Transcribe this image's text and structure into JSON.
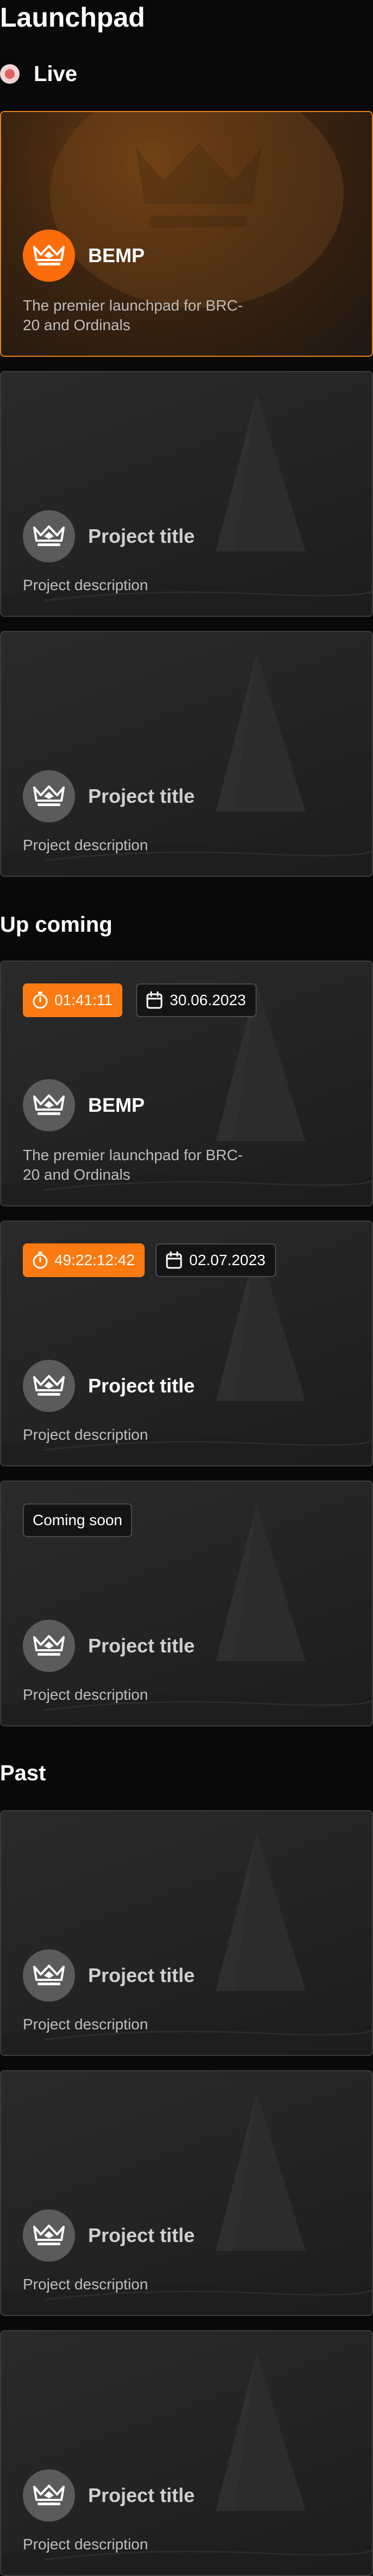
{
  "page": {
    "title": "Launchpad"
  },
  "colors": {
    "accent": "#fb6c0b",
    "card_border": "#3b3b3b",
    "live_border": "#e3841b",
    "background": "#090909"
  },
  "sections": {
    "live": {
      "title": "Live",
      "indicator": "live-indicator-icon"
    },
    "upcoming": {
      "title": "Up coming"
    },
    "past": {
      "title": "Past"
    }
  },
  "live_cards": [
    {
      "title": "BEMP",
      "description": "The premier launchpad for BRC-20 and Ordinals",
      "logo": "crown-logo-icon"
    },
    {
      "title": "Project title",
      "description": "Project description",
      "logo": "crown-logo-icon"
    },
    {
      "title": "Project title",
      "description": "Project description",
      "logo": "crown-logo-icon"
    }
  ],
  "upcoming_cards": [
    {
      "title": "BEMP",
      "description": "The premier launchpad for BRC-20 and Ordinals",
      "countdown": "01:41:11",
      "date": "30.06.2023",
      "timer_icon": "stopwatch-icon",
      "date_icon": "calendar-icon"
    },
    {
      "title": "Project title",
      "description": "Project description",
      "countdown": "49:22:12:42",
      "date": "02.07.2023",
      "timer_icon": "stopwatch-icon",
      "date_icon": "calendar-icon"
    },
    {
      "title": "Project title",
      "description": "Project description",
      "status": "Coming soon"
    }
  ],
  "past_cards": [
    {
      "title": "Project title",
      "description": "Project description"
    },
    {
      "title": "Project title",
      "description": "Project description"
    },
    {
      "title": "Project title",
      "description": "Project description"
    }
  ]
}
